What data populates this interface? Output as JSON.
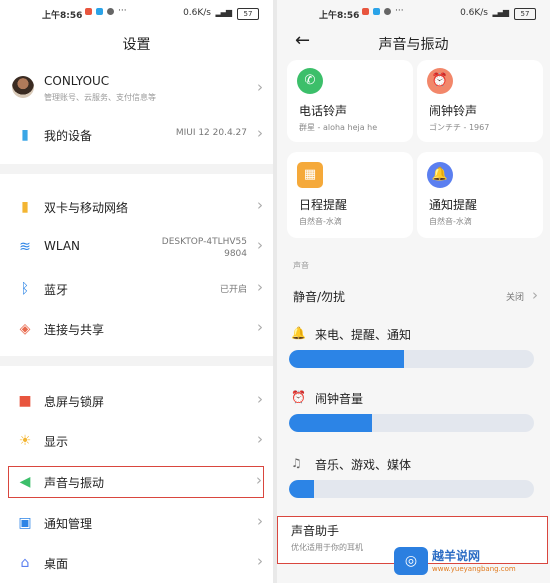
{
  "status": {
    "time": "上午8:56",
    "net": "0.6K/s",
    "battery": "57"
  },
  "left": {
    "title": "设置",
    "profile": {
      "name": "CONLYOUC",
      "sub": "管理账号、云服务、支付信息等"
    },
    "items": [
      {
        "label": "我的设备",
        "value": "MIUI 12 20.4.27",
        "icon": "device-icon"
      },
      {
        "label": "双卡与移动网络",
        "value": "",
        "icon": "sim-icon"
      },
      {
        "label": "WLAN",
        "value": "DESKTOP-4TLHV55\n9804",
        "icon": "wifi-icon"
      },
      {
        "label": "蓝牙",
        "value": "已开启",
        "icon": "bluetooth-icon"
      },
      {
        "label": "连接与共享",
        "value": "",
        "icon": "share-icon"
      },
      {
        "label": "息屏与锁屏",
        "value": "",
        "icon": "lock-icon"
      },
      {
        "label": "显示",
        "value": "",
        "icon": "sun-icon"
      },
      {
        "label": "声音与振动",
        "value": "",
        "icon": "speaker-icon"
      },
      {
        "label": "通知管理",
        "value": "",
        "icon": "notification-icon"
      },
      {
        "label": "桌面",
        "value": "",
        "icon": "home-icon"
      }
    ]
  },
  "right": {
    "title": "声音与振动",
    "cards": [
      {
        "title": "电话铃声",
        "sub": "群星 - aloha heja he",
        "icon": "phone-icon",
        "color": "#3cbf6a"
      },
      {
        "title": "闹钟铃声",
        "sub": "ゴンチチ - 1967",
        "icon": "alarm-icon",
        "color": "#f2876a"
      },
      {
        "title": "日程提醒",
        "sub": "自然音-水滴",
        "icon": "calendar-icon",
        "color": "#f5a93a"
      },
      {
        "title": "通知提醒",
        "sub": "自然音-水滴",
        "icon": "bell-icon",
        "color": "#5b7ff0"
      }
    ],
    "section": "声音",
    "mute": {
      "label": "静音/勿扰",
      "value": "关闭"
    },
    "volumes": [
      {
        "label": "来电、提醒、通知",
        "level": 0.47,
        "icon": "bell-small-icon"
      },
      {
        "label": "闹钟音量",
        "level": 0.34,
        "icon": "alarm-small-icon"
      },
      {
        "label": "音乐、游戏、媒体",
        "level": 0.1,
        "icon": "music-icon"
      }
    ],
    "bottom": {
      "label": "声音助手",
      "sub": "优化适用于你的耳机"
    }
  },
  "watermark": {
    "title": "越羊说网",
    "url": "www.yueyangbang.com"
  },
  "colors": {
    "accent": "#2c84e6",
    "highlight": "#d9463e"
  }
}
